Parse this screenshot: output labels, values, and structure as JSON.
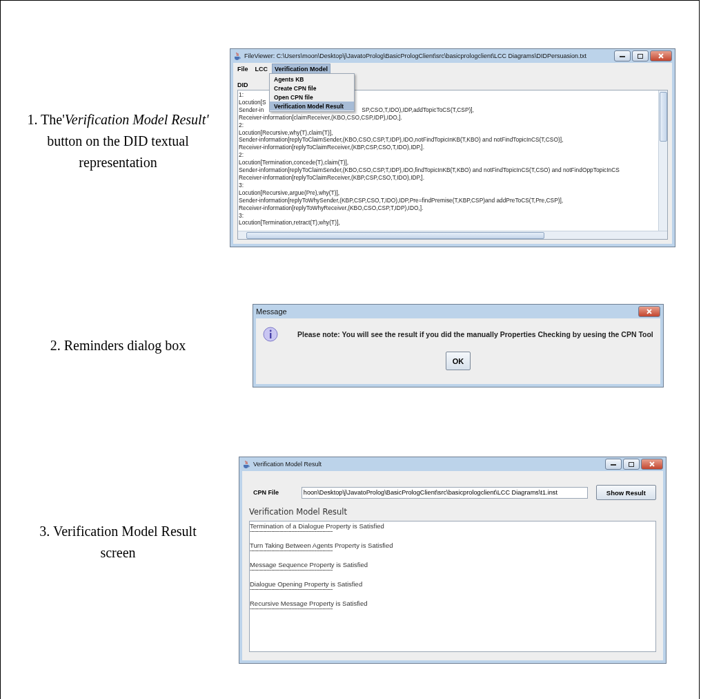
{
  "figure": {
    "steps": [
      {
        "caption": "1. The'*Verification Model Result'* button on the DID textual representation",
        "window": {
          "kind": "viewer",
          "title": "FileViewer: C:\\Users\\moon\\Desktop\\j\\JavatoProlog\\BasicPrologClient\\src\\basicprologclient\\LCC Diagrams\\DIDPersuasion.txt",
          "menu_bar": [
            {
              "label": "File",
              "selected": false
            },
            {
              "label": "LCC",
              "selected": false
            },
            {
              "label": "Verification Model",
              "selected": true
            }
          ],
          "dropdown": [
            {
              "label": "Agents KB",
              "selected": false
            },
            {
              "label": "Create CPN file",
              "selected": false
            },
            {
              "label": "Open CPN file",
              "selected": false
            },
            {
              "label": "Verification Model Result",
              "selected": true
            }
          ],
          "section_label": "DID",
          "lines": [
            {
              "text": "1:"
            },
            {
              "text": "Locution[S"
            },
            {
              "text": "Sender-in",
              "tail": "SP,CSO,T,IDO),IDP,addTopicToCS(T,CSP)],"
            },
            {
              "text": "Receiver-information[claimReceiver,(KBO,CSO,CSP,IDP),IDO,]."
            },
            {
              "text": "2:"
            },
            {
              "text": "Locution[Recursive,why(T),claim(T)],"
            },
            {
              "text": "Sender-information[replyToClaimSender,(KBO,CSO,CSP,T,IDP),IDO,notFindTopicInKB(T,KBO) and notFindTopicInCS(T,CSO)],"
            },
            {
              "text": "Receiver-information[replyToClaimReceiver,(KBP,CSP,CSO,T,IDO),IDP,]."
            },
            {
              "text": "2:"
            },
            {
              "text": "Locution[Termination,concede(T),claim(T)],"
            },
            {
              "text": "Sender-information[replyToClaimSender,(KBO,CSO,CSP,T,IDP),IDO,findTopicInKB(T,KBO) and notFindTopicInCS(T,CSO) and notFindOppTopicInCS"
            },
            {
              "text": "Receiver-information[replyToClaimReceiver,(KBP,CSP,CSO,T,IDO),IDP,]."
            },
            {
              "text": "3:"
            },
            {
              "text": "Locution[Recursive,argue(Pre),why(T)],"
            },
            {
              "text": "Sender-information[replyToWhySender,(KBP,CSP,CSO,T,IDO),IDP,Pre=findPremise(T,KBP,CSP)and addPreToCS(T,Pre,CSP)],"
            },
            {
              "text": "Receiver-information[replyToWhyReceiver,(KBO,CSO,CSP,T,IDP),IDO,]."
            },
            {
              "text": "3:"
            },
            {
              "text": "Locution[Termination,retract(T),why(T)],"
            }
          ]
        }
      },
      {
        "caption": "2. Reminders dialog box",
        "window": {
          "kind": "message",
          "title": "Message",
          "message": "Please note: You will see the result if you did the manually Properties Checking by uesing the CPN Tool",
          "button": "OK"
        }
      },
      {
        "caption": "3. Verification Model Result screen",
        "window": {
          "kind": "result",
          "title": "Verification Model Result",
          "file_label": "CPN File",
          "file_value": "hoon\\Desktop\\j\\JavatoProlog\\BasicPrologClient\\src\\basicprologclient\\LCC Diagrams\\t1.inst",
          "button": "Show Result",
          "heading": "Verification Model Result",
          "results": [
            {
              "text": "Termination of a Dialogue Property is Satisfied",
              "separator": "--------------------------------------------------"
            },
            {
              "text": "Turn Taking Between Agents Property is Satisfied",
              "separator": "--------------------------------------------------"
            },
            {
              "text": "Message Sequence Property  is Satisfied",
              "separator": "--------------------------------------------------"
            },
            {
              "text": "Dialogue Opening Property is Satisfied",
              "separator": "--------------------------------------------------"
            },
            {
              "text": "Recursive Message Property is Satisfied",
              "separator": "--------------------------------------------------"
            }
          ]
        }
      }
    ]
  }
}
